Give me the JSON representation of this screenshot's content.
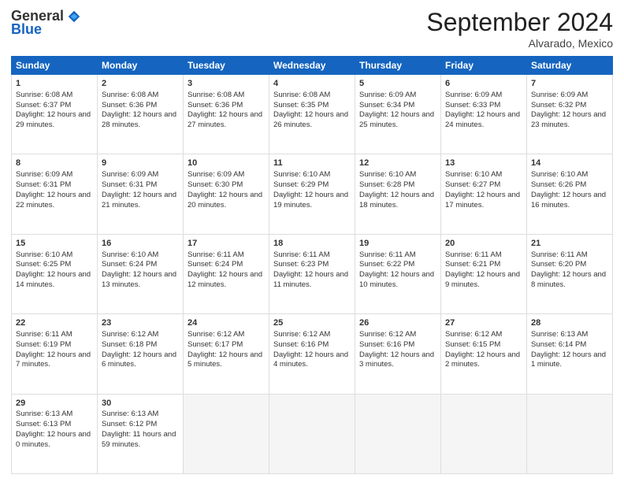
{
  "logo": {
    "general": "General",
    "blue": "Blue"
  },
  "title": "September 2024",
  "location": "Alvarado, Mexico",
  "days_of_week": [
    "Sunday",
    "Monday",
    "Tuesday",
    "Wednesday",
    "Thursday",
    "Friday",
    "Saturday"
  ],
  "weeks": [
    [
      {
        "day": "1",
        "sunrise": "6:08 AM",
        "sunset": "6:37 PM",
        "daylight": "12 hours and 29 minutes."
      },
      {
        "day": "2",
        "sunrise": "6:08 AM",
        "sunset": "6:36 PM",
        "daylight": "12 hours and 28 minutes."
      },
      {
        "day": "3",
        "sunrise": "6:08 AM",
        "sunset": "6:36 PM",
        "daylight": "12 hours and 27 minutes."
      },
      {
        "day": "4",
        "sunrise": "6:08 AM",
        "sunset": "6:35 PM",
        "daylight": "12 hours and 26 minutes."
      },
      {
        "day": "5",
        "sunrise": "6:09 AM",
        "sunset": "6:34 PM",
        "daylight": "12 hours and 25 minutes."
      },
      {
        "day": "6",
        "sunrise": "6:09 AM",
        "sunset": "6:33 PM",
        "daylight": "12 hours and 24 minutes."
      },
      {
        "day": "7",
        "sunrise": "6:09 AM",
        "sunset": "6:32 PM",
        "daylight": "12 hours and 23 minutes."
      }
    ],
    [
      {
        "day": "8",
        "sunrise": "6:09 AM",
        "sunset": "6:31 PM",
        "daylight": "12 hours and 22 minutes."
      },
      {
        "day": "9",
        "sunrise": "6:09 AM",
        "sunset": "6:31 PM",
        "daylight": "12 hours and 21 minutes."
      },
      {
        "day": "10",
        "sunrise": "6:09 AM",
        "sunset": "6:30 PM",
        "daylight": "12 hours and 20 minutes."
      },
      {
        "day": "11",
        "sunrise": "6:10 AM",
        "sunset": "6:29 PM",
        "daylight": "12 hours and 19 minutes."
      },
      {
        "day": "12",
        "sunrise": "6:10 AM",
        "sunset": "6:28 PM",
        "daylight": "12 hours and 18 minutes."
      },
      {
        "day": "13",
        "sunrise": "6:10 AM",
        "sunset": "6:27 PM",
        "daylight": "12 hours and 17 minutes."
      },
      {
        "day": "14",
        "sunrise": "6:10 AM",
        "sunset": "6:26 PM",
        "daylight": "12 hours and 16 minutes."
      }
    ],
    [
      {
        "day": "15",
        "sunrise": "6:10 AM",
        "sunset": "6:25 PM",
        "daylight": "12 hours and 14 minutes."
      },
      {
        "day": "16",
        "sunrise": "6:10 AM",
        "sunset": "6:24 PM",
        "daylight": "12 hours and 13 minutes."
      },
      {
        "day": "17",
        "sunrise": "6:11 AM",
        "sunset": "6:24 PM",
        "daylight": "12 hours and 12 minutes."
      },
      {
        "day": "18",
        "sunrise": "6:11 AM",
        "sunset": "6:23 PM",
        "daylight": "12 hours and 11 minutes."
      },
      {
        "day": "19",
        "sunrise": "6:11 AM",
        "sunset": "6:22 PM",
        "daylight": "12 hours and 10 minutes."
      },
      {
        "day": "20",
        "sunrise": "6:11 AM",
        "sunset": "6:21 PM",
        "daylight": "12 hours and 9 minutes."
      },
      {
        "day": "21",
        "sunrise": "6:11 AM",
        "sunset": "6:20 PM",
        "daylight": "12 hours and 8 minutes."
      }
    ],
    [
      {
        "day": "22",
        "sunrise": "6:11 AM",
        "sunset": "6:19 PM",
        "daylight": "12 hours and 7 minutes."
      },
      {
        "day": "23",
        "sunrise": "6:12 AM",
        "sunset": "6:18 PM",
        "daylight": "12 hours and 6 minutes."
      },
      {
        "day": "24",
        "sunrise": "6:12 AM",
        "sunset": "6:17 PM",
        "daylight": "12 hours and 5 minutes."
      },
      {
        "day": "25",
        "sunrise": "6:12 AM",
        "sunset": "6:16 PM",
        "daylight": "12 hours and 4 minutes."
      },
      {
        "day": "26",
        "sunrise": "6:12 AM",
        "sunset": "6:16 PM",
        "daylight": "12 hours and 3 minutes."
      },
      {
        "day": "27",
        "sunrise": "6:12 AM",
        "sunset": "6:15 PM",
        "daylight": "12 hours and 2 minutes."
      },
      {
        "day": "28",
        "sunrise": "6:13 AM",
        "sunset": "6:14 PM",
        "daylight": "12 hours and 1 minute."
      }
    ],
    [
      {
        "day": "29",
        "sunrise": "6:13 AM",
        "sunset": "6:13 PM",
        "daylight": "12 hours and 0 minutes."
      },
      {
        "day": "30",
        "sunrise": "6:13 AM",
        "sunset": "6:12 PM",
        "daylight": "11 hours and 59 minutes."
      },
      null,
      null,
      null,
      null,
      null
    ]
  ],
  "labels": {
    "sunrise": "Sunrise:",
    "sunset": "Sunset:",
    "daylight": "Daylight:"
  }
}
